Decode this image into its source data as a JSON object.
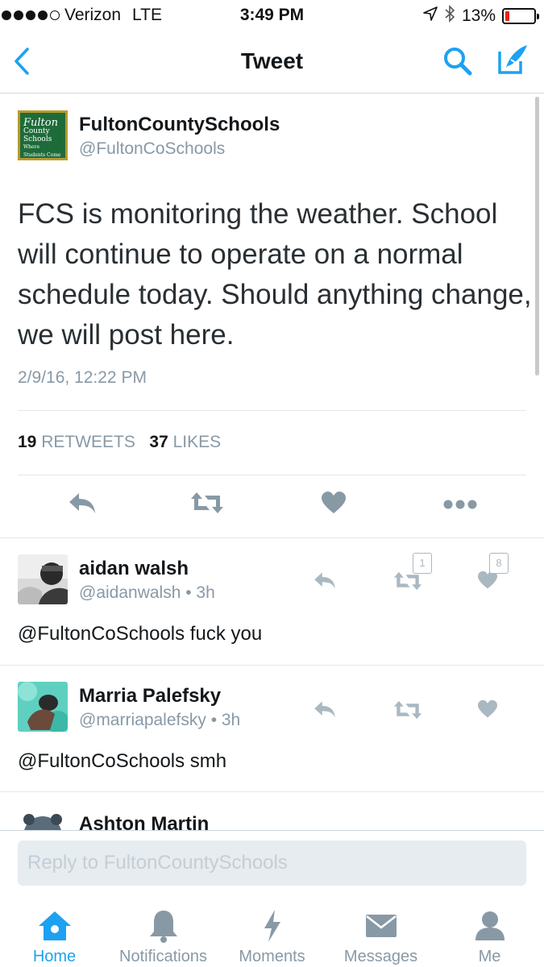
{
  "status_bar": {
    "carrier": "Verizon",
    "network": "LTE",
    "time": "3:49 PM",
    "battery_text": "13%",
    "battery_level": 0.13,
    "battery_color": "#e0251b"
  },
  "nav": {
    "title": "Tweet",
    "icons": [
      "back-chevron-icon",
      "search-icon",
      "compose-icon"
    ],
    "accent": "#1da1f2"
  },
  "tweet": {
    "avatar_lines": [
      "Fulton",
      "County Schools",
      "Where Students Come First"
    ],
    "display_name": "FultonCountySchools",
    "handle": "@FultonCoSchools",
    "text": "FCS is monitoring the weather. School will continue to operate on a normal schedule today.  Should anything change, we will post here.",
    "timestamp": "2/9/16, 12:22 PM",
    "retweets_count": "19",
    "retweets_label": "RETWEETS",
    "likes_count": "37",
    "likes_label": "LIKES",
    "actions": [
      "reply-icon",
      "retweet-icon",
      "heart-icon",
      "more-icon"
    ]
  },
  "replies": [
    {
      "display_name": "aidan walsh",
      "handle": "@aidanwalsh • 3h",
      "text": "@FultonCoSchools fuck you",
      "retweet_count": "1",
      "like_count": "8"
    },
    {
      "display_name": "Marria Palefsky",
      "handle": "@marriapalefsky • 3h",
      "text": "@FultonCoSchools smh",
      "retweet_count": "",
      "like_count": ""
    },
    {
      "display_name": "Ashton Martin"
    }
  ],
  "reply_box": {
    "placeholder": "Reply to FultonCountySchools"
  },
  "tab_bar": {
    "tabs": [
      {
        "label": "Home",
        "icon": "home-icon",
        "active": true
      },
      {
        "label": "Notifications",
        "icon": "bell-icon",
        "active": false
      },
      {
        "label": "Moments",
        "icon": "lightning-icon",
        "active": false
      },
      {
        "label": "Messages",
        "icon": "envelope-icon",
        "active": false
      },
      {
        "label": "Me",
        "icon": "person-icon",
        "active": false
      }
    ]
  }
}
